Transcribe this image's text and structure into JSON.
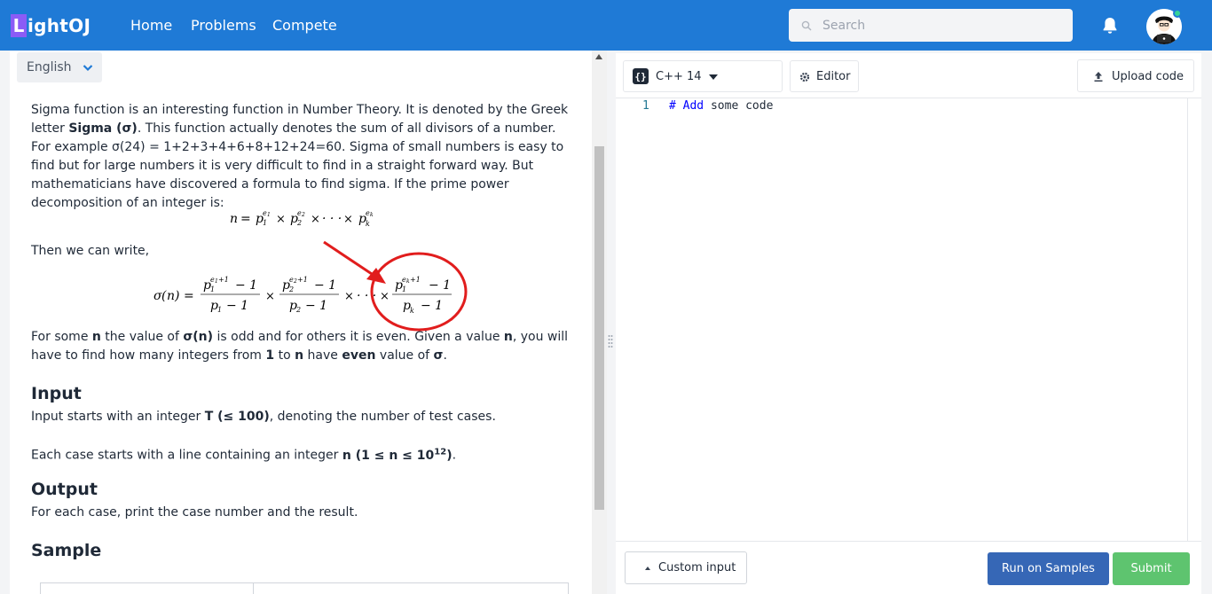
{
  "header": {
    "logo_first": "L",
    "logo_rest": "ightOJ",
    "nav": [
      "Home",
      "Problems",
      "Compete"
    ],
    "search_placeholder": "Search"
  },
  "problem": {
    "language": "English",
    "intro_1": "Sigma function is an interesting function in Number Theory. It is denoted by the Greek letter ",
    "intro_bold": "Sigma (σ)",
    "intro_2": ". This function actually denotes the sum of all divisors of a number. For example σ(24) = 1+2+3+4+6+8+12+24=60. Sigma of small numbers is easy to find but for large numbers it is very difficult to find in a straight forward way. But mathematicians have discovered a formula to find sigma. If the prime power decomposition of an integer is:",
    "then_text": "Then we can write,",
    "task_1": "For some ",
    "task_n1": "n",
    "task_2": " the value of ",
    "task_sigma_n": "σ(n)",
    "task_3": " is odd and for others it is even. Given a value ",
    "task_n2": "n",
    "task_4": ", you will have to find how many integers from ",
    "task_one": "1",
    "task_5": " to ",
    "task_n3": "n",
    "task_6": " have ",
    "task_even": "even",
    "task_7": " value of ",
    "task_sigma": "σ",
    "task_8": ".",
    "input_heading": "Input",
    "input_1a": "Input starts with an integer ",
    "input_1b": "T (≤ 100)",
    "input_1c": ", denoting the number of test cases.",
    "input_2a": "Each case starts with a line containing an integer ",
    "input_2b": "n (1 ≤ n ≤ 10",
    "input_2sup": "12",
    "input_2c": ")",
    "input_2d": ".",
    "output_heading": "Output",
    "output_text": "For each case, print the case number and the result.",
    "sample_heading": "Sample"
  },
  "editor": {
    "language_select": "C++ 14",
    "editor_btn": "Editor",
    "upload_btn": "Upload code",
    "line_number": "1",
    "code_hash": "#",
    "code_kw": "Add",
    "code_rest": " some code",
    "custom_input_btn": "Custom input",
    "run_btn": "Run on Samples",
    "submit_btn": "Submit"
  },
  "colors": {
    "header": "#1f7ad6",
    "logo_accent": "#8b5cf6",
    "run": "#3667b6",
    "submit": "#5ec46f",
    "annotation": "#e11d1d"
  }
}
